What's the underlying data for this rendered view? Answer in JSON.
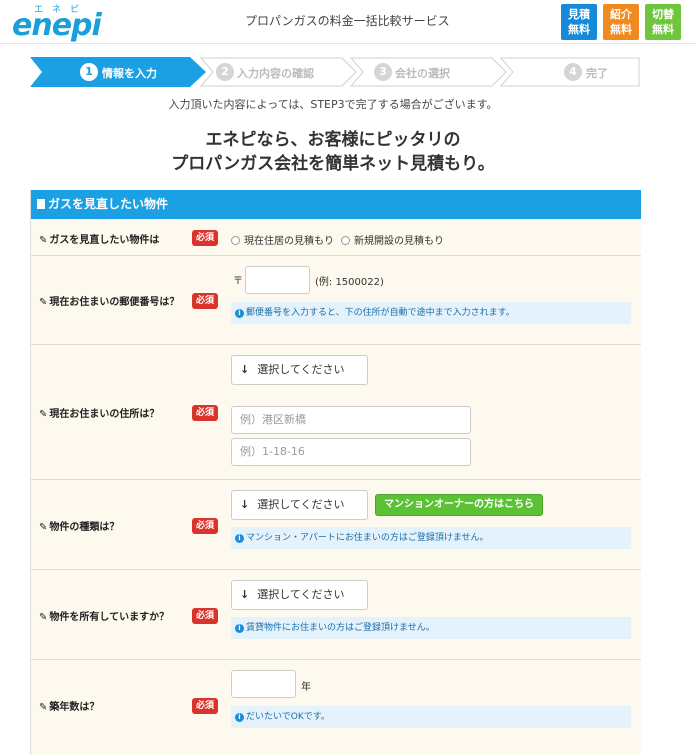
{
  "header": {
    "logo_kana": "エネピ",
    "logo_word": "enepi",
    "tagline": "プロパンガスの料金一括比較サービス",
    "badges": [
      {
        "line1": "見積",
        "line2": "無料",
        "color": "#1689d8"
      },
      {
        "line1": "紹介",
        "line2": "無料",
        "color": "#f18a1e"
      },
      {
        "line1": "切替",
        "line2": "無料",
        "color": "#6fc63c"
      }
    ]
  },
  "steps": [
    {
      "num": "1",
      "label": "情報を入力",
      "active": true
    },
    {
      "num": "2",
      "label": "入力内容の確認",
      "active": false
    },
    {
      "num": "3",
      "label": "会社の選択",
      "active": false
    },
    {
      "num": "4",
      "label": "完了",
      "active": false
    }
  ],
  "note": "入力頂いた内容によっては、STEP3で完了する場合がございます。",
  "hero": {
    "line1": "エネピなら、お客様にピッタリの",
    "line2": "プロパンガス会社を簡単ネット見積もり。"
  },
  "form": {
    "section_title": "ガスを見直したい物件",
    "required_label": "必須",
    "rows": {
      "property": {
        "label": "ガスを見直したい物件は",
        "options": [
          "現在住居の見積もり",
          "新規開設の見積もり"
        ]
      },
      "postal": {
        "label": "現在お住まいの郵便番号は？",
        "prefix": "〒",
        "value": "",
        "example": "(例: 1500022)",
        "info": "郵便番号を入力すると、下の住所が自動で途中まで入力されます。"
      },
      "address": {
        "label": "現在お住まいの住所は？",
        "select": "選択してください",
        "placeholder1": "例）港区新橋",
        "placeholder2": "例）1-18-16"
      },
      "type": {
        "label": "物件の種類は？",
        "select": "選択してください",
        "button": "マンションオーナーの方はこちら",
        "info": "マンション・アパートにお住まいの方はご登録頂けません。"
      },
      "ownership": {
        "label": "物件を所有していますか？",
        "select": "選択してください",
        "info": "賃貸物件にお住まいの方はご登録頂けません。"
      },
      "age": {
        "label": "築年数は？",
        "value": "",
        "unit": "年",
        "info": "だいたいでOKです。"
      }
    }
  },
  "colors": {
    "primary": "#1ca0e4",
    "required": "#d9342b",
    "row_bg": "#fdf9ee",
    "info_bg": "#e4f2fc",
    "green": "#5bc236"
  }
}
